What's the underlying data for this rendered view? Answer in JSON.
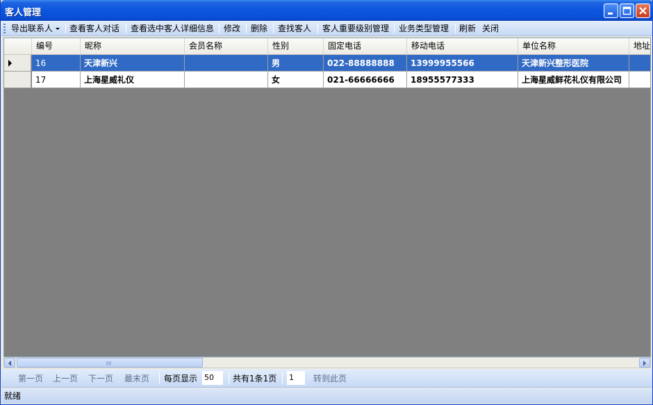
{
  "window": {
    "title": "客人管理"
  },
  "toolbar": {
    "export_label": "导出联系人",
    "view_dialog_label": "查看客人对话",
    "view_detail_label": "查看选中客人详细信息",
    "edit_label": "修改",
    "delete_label": "删除",
    "find_label": "查找客人",
    "level_mgmt_label": "客人重要级别管理",
    "biztype_mgmt_label": "业务类型管理",
    "refresh_label": "刷新",
    "close_label": "关闭"
  },
  "grid": {
    "columns": [
      "编号",
      "昵称",
      "会员名称",
      "性别",
      "固定电话",
      "移动电话",
      "单位名称",
      "地址"
    ],
    "rows": [
      {
        "id": "16",
        "nickname": "天津新兴",
        "member": "",
        "gender": "男",
        "phone": "022-88888888",
        "mobile": "13999955566",
        "company": "天津新兴整形医院",
        "address": ""
      },
      {
        "id": "17",
        "nickname": "上海星威礼仪",
        "member": "",
        "gender": "女",
        "phone": "021-66666666",
        "mobile": "18955577333",
        "company": "上海星威鲜花礼仪有限公司",
        "address": ""
      }
    ]
  },
  "pager": {
    "first": "第一页",
    "prev": "上一页",
    "next": "下一页",
    "last": "最末页",
    "per_page_label": "每页显示",
    "per_page_value": "50",
    "summary": "共有1条1页",
    "page_value": "1",
    "goto": "转到此页"
  },
  "status": {
    "text": "就绪"
  },
  "colors": {
    "title_bar": "#0b55df",
    "selection": "#316ac5",
    "grid_background": "#808080",
    "toolbar": "#c6d9f5"
  }
}
